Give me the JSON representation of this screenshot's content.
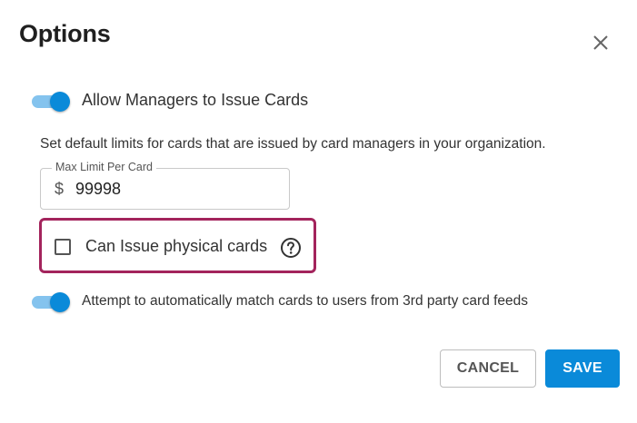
{
  "dialog": {
    "title": "Options",
    "close_icon": "close-icon",
    "allow_managers": {
      "label": "Allow Managers to Issue Cards",
      "enabled": true
    },
    "description": "Set default limits for cards that are issued by card managers in your organization.",
    "max_limit": {
      "label": "Max Limit Per Card",
      "currency": "$",
      "value": "99998"
    },
    "physical_cards": {
      "label": "Can Issue physical cards",
      "checked": false,
      "help_icon": "question-circle-icon"
    },
    "auto_match": {
      "label": "Attempt to automatically match cards to users from 3rd party card feeds",
      "enabled": true
    },
    "buttons": {
      "cancel": "CANCEL",
      "save": "SAVE"
    }
  },
  "colors": {
    "accent": "#0a8ad9",
    "toggle_track": "#84c3ee",
    "highlight_border": "#a3245c"
  }
}
